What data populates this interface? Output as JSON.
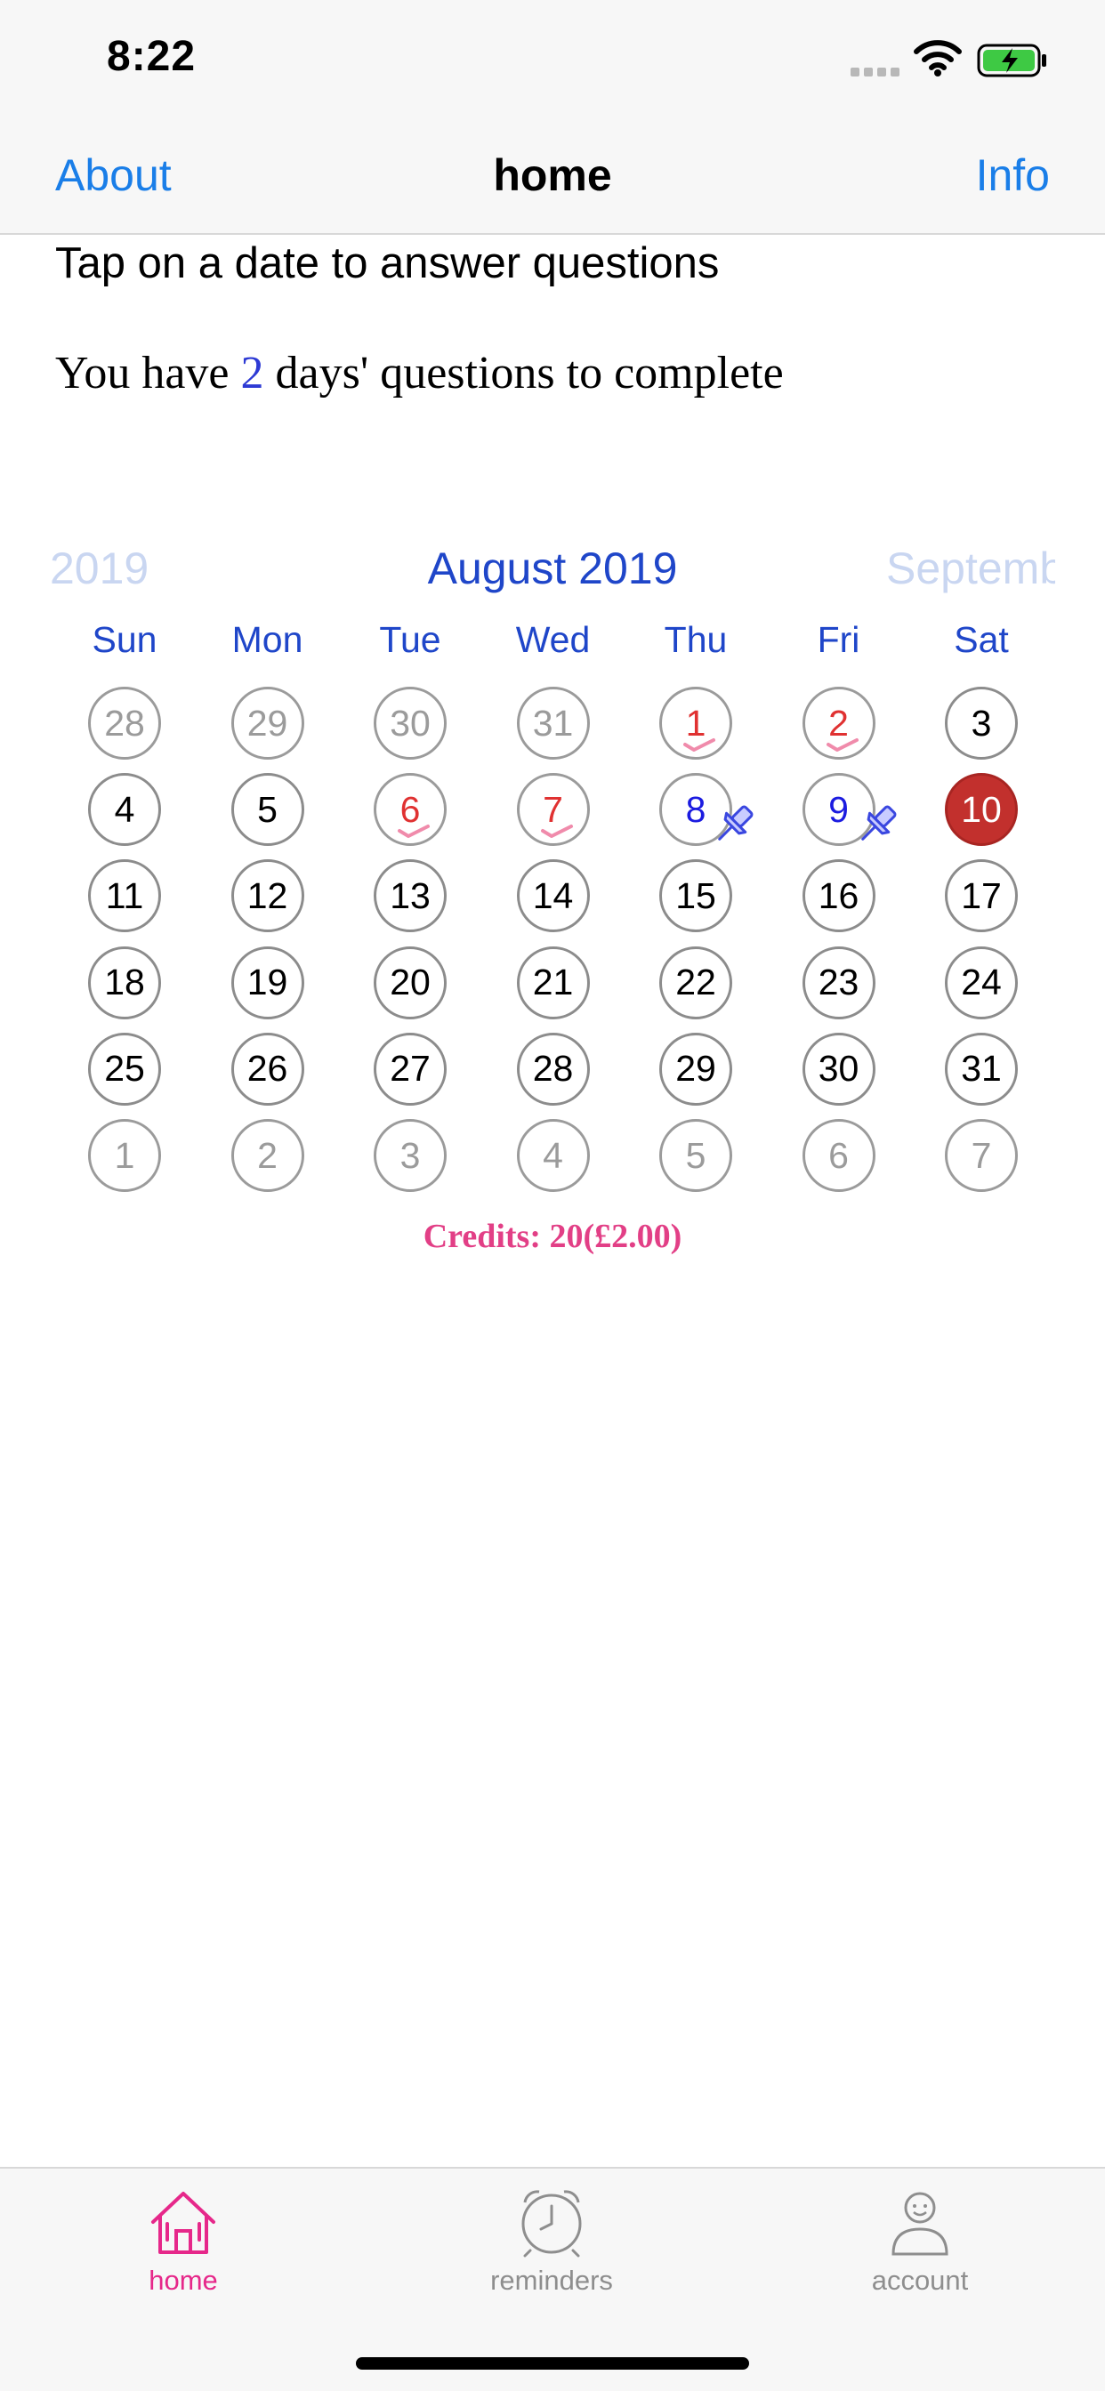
{
  "status_bar": {
    "time": "8:22"
  },
  "nav": {
    "left": "About",
    "title": "home",
    "right": "Info"
  },
  "content": {
    "intro": "Tap on a date to answer questions",
    "remaining_prefix": "You have ",
    "remaining_count": "2",
    "remaining_suffix": " days' questions to complete"
  },
  "calendar": {
    "prev_month": "2019",
    "month": "August 2019",
    "next_month": "Septemb",
    "weekdays": [
      "Sun",
      "Mon",
      "Tue",
      "Wed",
      "Thu",
      "Fri",
      "Sat"
    ],
    "weeks": [
      [
        "28",
        "29",
        "30",
        "31",
        "1",
        "2",
        "3"
      ],
      [
        "4",
        "5",
        "6",
        "7",
        "8",
        "9",
        "10"
      ],
      [
        "11",
        "12",
        "13",
        "14",
        "15",
        "16",
        "17"
      ],
      [
        "18",
        "19",
        "20",
        "21",
        "22",
        "23",
        "24"
      ],
      [
        "25",
        "26",
        "27",
        "28",
        "29",
        "30",
        "31"
      ],
      [
        "1",
        "2",
        "3",
        "4",
        "5",
        "6",
        "7"
      ]
    ],
    "states": [
      [
        "out",
        "out",
        "out",
        "out",
        "done",
        "done",
        "cur"
      ],
      [
        "cur",
        "cur",
        "done",
        "done",
        "pending",
        "pending",
        "today"
      ],
      [
        "cur",
        "cur",
        "cur",
        "cur",
        "cur",
        "cur",
        "cur"
      ],
      [
        "cur",
        "cur",
        "cur",
        "cur",
        "cur",
        "cur",
        "cur"
      ],
      [
        "cur",
        "cur",
        "cur",
        "cur",
        "cur",
        "cur",
        "cur"
      ],
      [
        "out",
        "out",
        "out",
        "out",
        "out",
        "out",
        "out"
      ]
    ]
  },
  "credits": "Credits: 20(£2.00)",
  "tabs": [
    {
      "label": "home",
      "icon": "home-icon",
      "active": true
    },
    {
      "label": "reminders",
      "icon": "alarm-clock-icon",
      "active": false
    },
    {
      "label": "account",
      "icon": "person-icon",
      "active": false
    }
  ],
  "colors": {
    "accent": "#1a7ee8",
    "calendar_blue": "#1f46c9",
    "completed_red": "#e03131",
    "pending_blue": "#1b1be0",
    "today_fill": "#c2302d",
    "credits_pink": "#e23f86",
    "tab_active": "#e6288a"
  }
}
